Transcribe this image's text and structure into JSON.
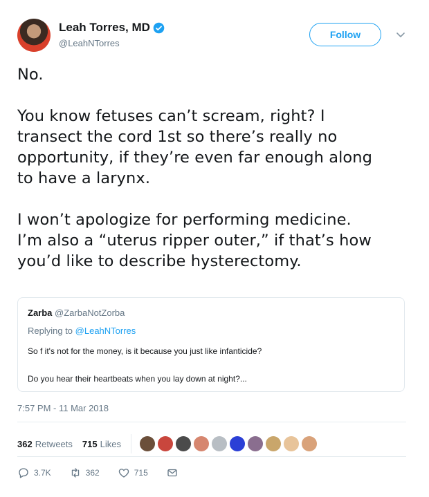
{
  "author": {
    "name": "Leah Torres, MD",
    "handle": "@LeahNTorres",
    "verified": true
  },
  "follow_label": "Follow",
  "tweet_text": "No.\n\nYou know fetuses can’t scream, right? I\ntransect the cord 1st so there’s really no\nopportunity, if they’re even far enough along\nto have a larynx.\n\nI won’t apologize for performing medicine.\nI’m also a “uterus ripper outer,” if that’s how\nyou’d like to describe hysterectomy.",
  "quoted": {
    "name": "Zarba",
    "handle": "@ZarbaNotZorba",
    "replying_prefix": "Replying to ",
    "replying_to": "@LeahNTorres",
    "line1": "So f it's not for the money, is it because you just like infanticide?",
    "line2": "Do you hear their heartbeats when you lay down at night?..."
  },
  "timestamp": "7:57 PM - 11 Mar 2018",
  "stats": {
    "retweets": "362",
    "retweets_label": "Retweets",
    "likes": "715",
    "likes_label": "Likes"
  },
  "liker_avatar_colors": [
    "#6b4f3a",
    "#c9463d",
    "#4b4b4b",
    "#d6866f",
    "#b8bec4",
    "#2b3fd6",
    "#8a6e8f",
    "#c9a66b",
    "#e8c49a",
    "#d9a27a"
  ],
  "actions": {
    "replies": "3.7K",
    "retweets": "362",
    "likes": "715"
  },
  "icons": [
    "verified-badge-icon",
    "chevron-down-icon",
    "reply-icon",
    "retweet-icon",
    "heart-icon",
    "message-icon"
  ],
  "colors": {
    "accent": "#1da1f2",
    "secondary_text": "#657786",
    "border": "#e1e8ed"
  }
}
